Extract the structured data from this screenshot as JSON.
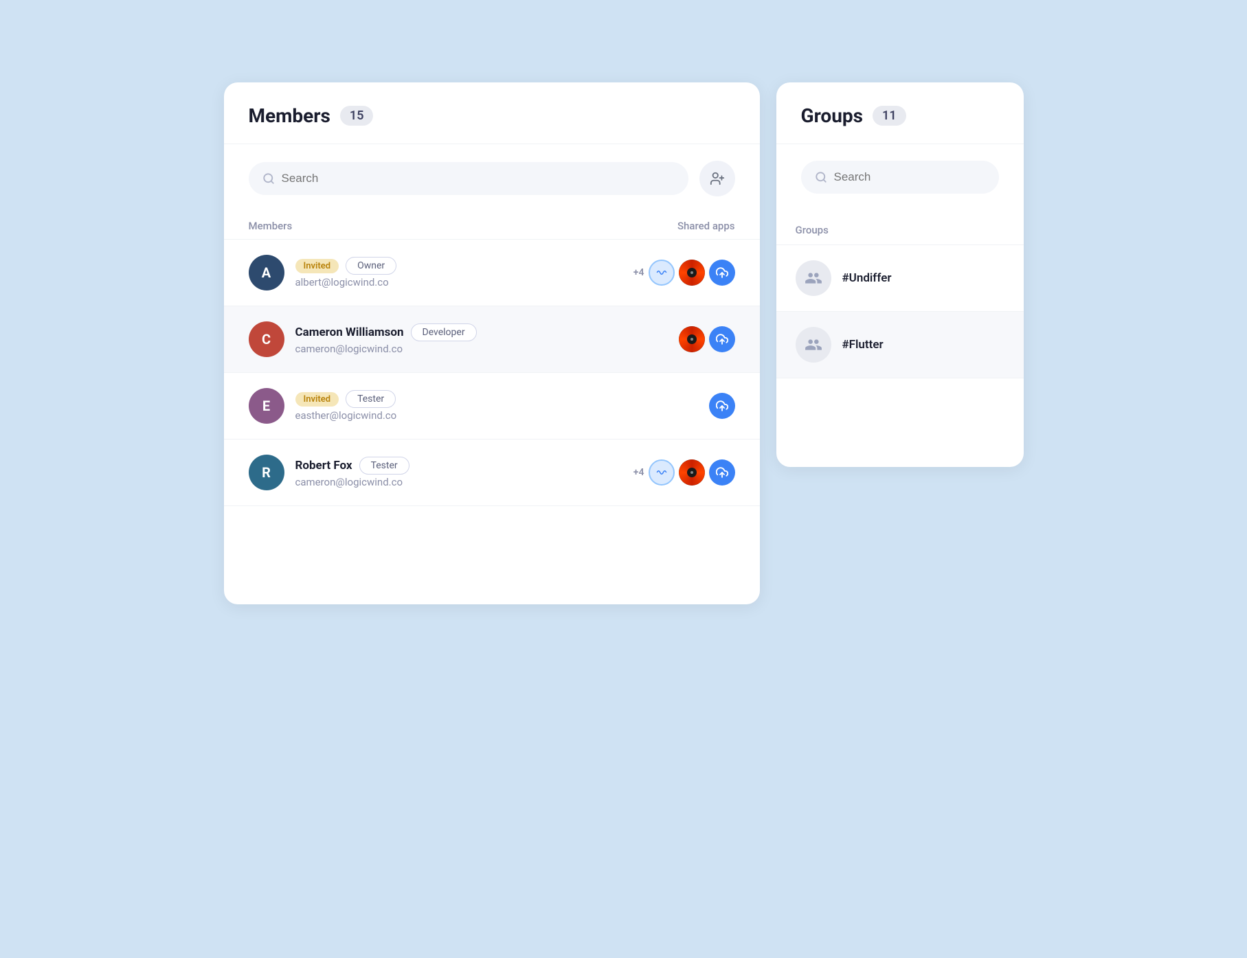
{
  "members_panel": {
    "title": "Members",
    "count": "15",
    "search_placeholder": "Search",
    "add_member_label": "Add Member",
    "column_members": "Members",
    "column_shared_apps": "Shared apps",
    "members": [
      {
        "id": "albert",
        "initial": "A",
        "avatar_color": "dark-blue",
        "invited": true,
        "invited_label": "Invited",
        "name": "",
        "email": "albert@logicwind.co",
        "role": "Owner",
        "apps": [
          "+4",
          "vinyl",
          "upload"
        ],
        "highlighted": false
      },
      {
        "id": "cameron",
        "initial": "C",
        "avatar_color": "red",
        "invited": false,
        "name": "Cameron Williamson",
        "email": "cameron@logicwind.co",
        "role": "Developer",
        "apps": [
          "vinyl",
          "upload"
        ],
        "highlighted": true
      },
      {
        "id": "easther",
        "initial": "E",
        "avatar_color": "purple",
        "invited": true,
        "invited_label": "Invited",
        "name": "",
        "email": "easther@logicwind.co",
        "role": "Tester",
        "apps": [
          "upload"
        ],
        "highlighted": false
      },
      {
        "id": "robert",
        "initial": "R",
        "avatar_color": "teal",
        "invited": false,
        "name": "Robert Fox",
        "email": "cameron@logicwind.co",
        "role": "Tester",
        "apps": [
          "+4",
          "wave",
          "vinyl",
          "upload"
        ],
        "highlighted": false
      }
    ]
  },
  "groups_panel": {
    "title": "Groups",
    "count": "11",
    "search_placeholder": "Search",
    "groups_label": "Groups",
    "groups": [
      {
        "id": "undiffer",
        "name": "#Undiffer",
        "highlighted": false
      },
      {
        "id": "flutter",
        "name": "#Flutter",
        "highlighted": true
      }
    ]
  }
}
